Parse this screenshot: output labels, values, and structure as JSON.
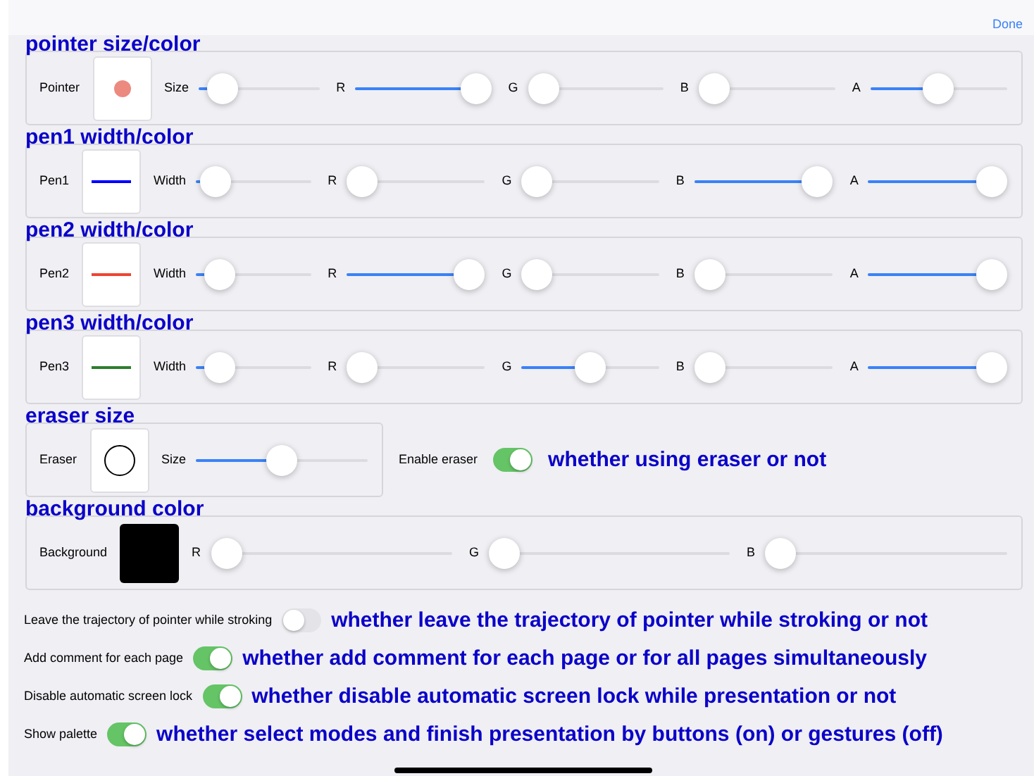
{
  "top_bar": {
    "done": "Done"
  },
  "groups": [
    {
      "kind": "sliders",
      "heading": "pointer size/color",
      "label": "Pointer",
      "preview": {
        "kind": "dot",
        "color": "#ec8a80"
      },
      "sliders": [
        {
          "label": "Size",
          "level": 0.1
        },
        {
          "label": "R",
          "level": 1
        },
        {
          "label": "G",
          "level": 0
        },
        {
          "label": "B",
          "level": 0
        },
        {
          "label": "A",
          "level": 0.5
        }
      ]
    },
    {
      "kind": "sliders",
      "heading": "pen1 width/color",
      "label": "Pen1",
      "preview": {
        "kind": "line",
        "color": "#0000ff"
      },
      "sliders": [
        {
          "label": "Width",
          "level": 0.05
        },
        {
          "label": "R",
          "level": 0
        },
        {
          "label": "G",
          "level": 0
        },
        {
          "label": "B",
          "level": 1
        },
        {
          "label": "A",
          "level": 1
        }
      ]
    },
    {
      "kind": "sliders",
      "heading": "pen2 width/color",
      "label": "Pen2",
      "preview": {
        "kind": "line",
        "color": "#ee4433"
      },
      "sliders": [
        {
          "label": "Width",
          "level": 0.1
        },
        {
          "label": "R",
          "level": 1
        },
        {
          "label": "G",
          "level": 0
        },
        {
          "label": "B",
          "level": 0
        },
        {
          "label": "A",
          "level": 1
        }
      ]
    },
    {
      "kind": "sliders",
      "heading": "pen3 width/color",
      "label": "Pen3",
      "preview": {
        "kind": "line",
        "color": "#2e7d2e"
      },
      "sliders": [
        {
          "label": "Width",
          "level": 0.1
        },
        {
          "label": "R",
          "level": 0
        },
        {
          "label": "G",
          "level": 0.5
        },
        {
          "label": "B",
          "level": 0
        },
        {
          "label": "A",
          "level": 1
        }
      ]
    },
    {
      "kind": "eraser",
      "heading": "eraser size",
      "label": "Eraser",
      "preview": {
        "kind": "circle",
        "color": "#000000"
      },
      "sliders": [
        {
          "label": "Size",
          "level": 0.5
        }
      ],
      "toggle": {
        "label": "Enable eraser",
        "on": true,
        "note": "whether using eraser or not"
      }
    },
    {
      "kind": "sliders",
      "heading": "background color",
      "label": "Background",
      "preview": {
        "kind": "swatch",
        "color": "#000000"
      },
      "sliders": [
        {
          "label": "R",
          "level": 0
        },
        {
          "label": "G",
          "level": 0
        },
        {
          "label": "B",
          "level": 0
        }
      ]
    }
  ],
  "toggles": [
    {
      "label": "Leave the trajectory of pointer while stroking",
      "on": false,
      "note": "whether leave the trajectory of pointer while stroking or not"
    },
    {
      "label": "Add comment for each page",
      "on": true,
      "note": "whether add comment for each page or for all pages simultaneously"
    },
    {
      "label": "Disable automatic screen lock",
      "on": true,
      "note": "whether disable automatic screen lock while presentation or not"
    },
    {
      "label": "Show palette",
      "on": true,
      "note": "whether select modes and finish presentation by buttons (on) or gestures (off)"
    }
  ]
}
